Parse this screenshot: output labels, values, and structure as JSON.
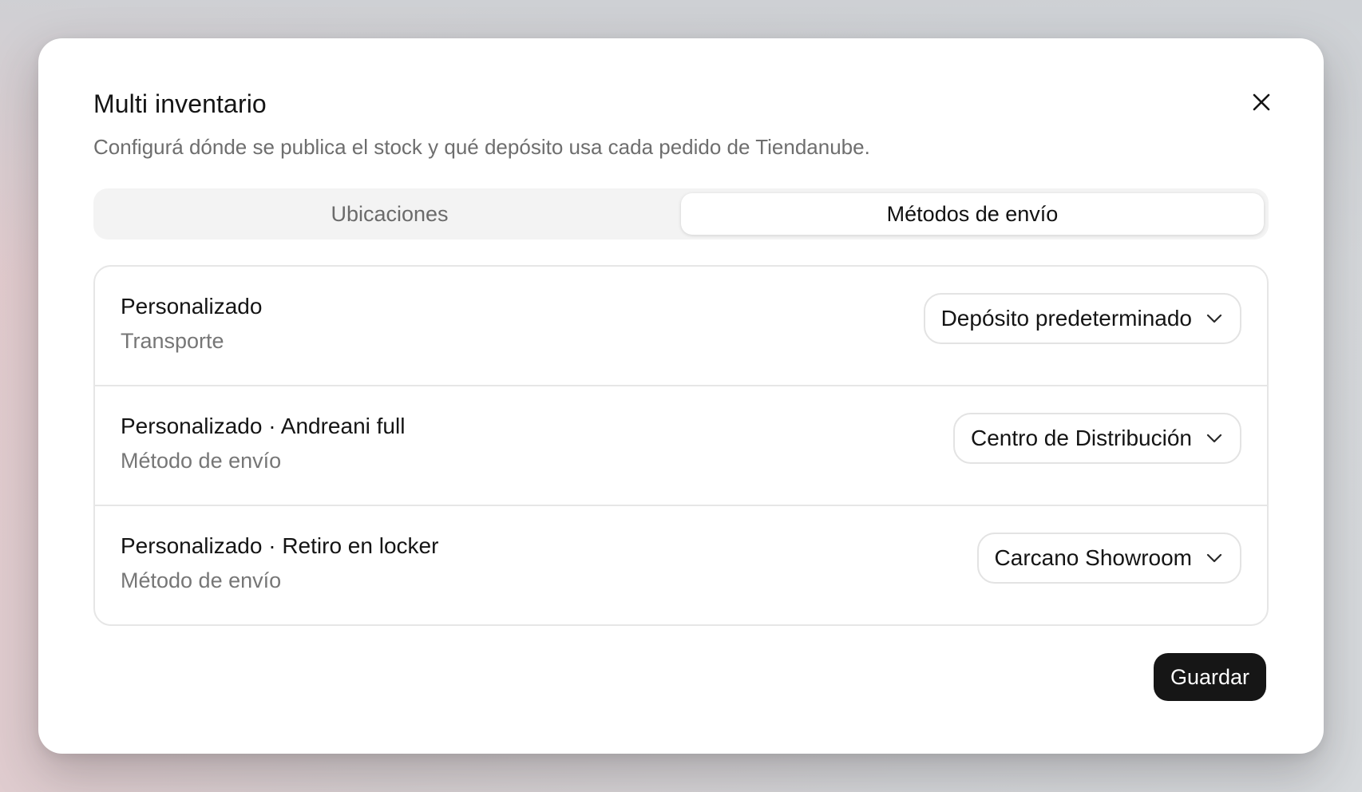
{
  "modal": {
    "title": "Multi inventario",
    "subtitle": "Configurá dónde se publica el stock y qué depósito usa cada pedido de Tiendanube.",
    "close_icon": "close-icon"
  },
  "tabs": [
    {
      "label": "Ubicaciones",
      "active": false
    },
    {
      "label": "Métodos de envío",
      "active": true
    }
  ],
  "shipping_methods": [
    {
      "title": "Personalizado",
      "subtitle": "Transporte",
      "warehouse": "Depósito predeterminado"
    },
    {
      "title": "Personalizado · Andreani full",
      "subtitle": "Método de envío",
      "warehouse": "Centro de Distribución"
    },
    {
      "title": "Personalizado · Retiro en locker",
      "subtitle": "Método de envío",
      "warehouse": "Carcano Showroom"
    }
  ],
  "footer": {
    "save_label": "Guardar"
  },
  "colors": {
    "primary_button": "#161616",
    "border": "#e6e6e6",
    "muted_text": "#767676"
  }
}
